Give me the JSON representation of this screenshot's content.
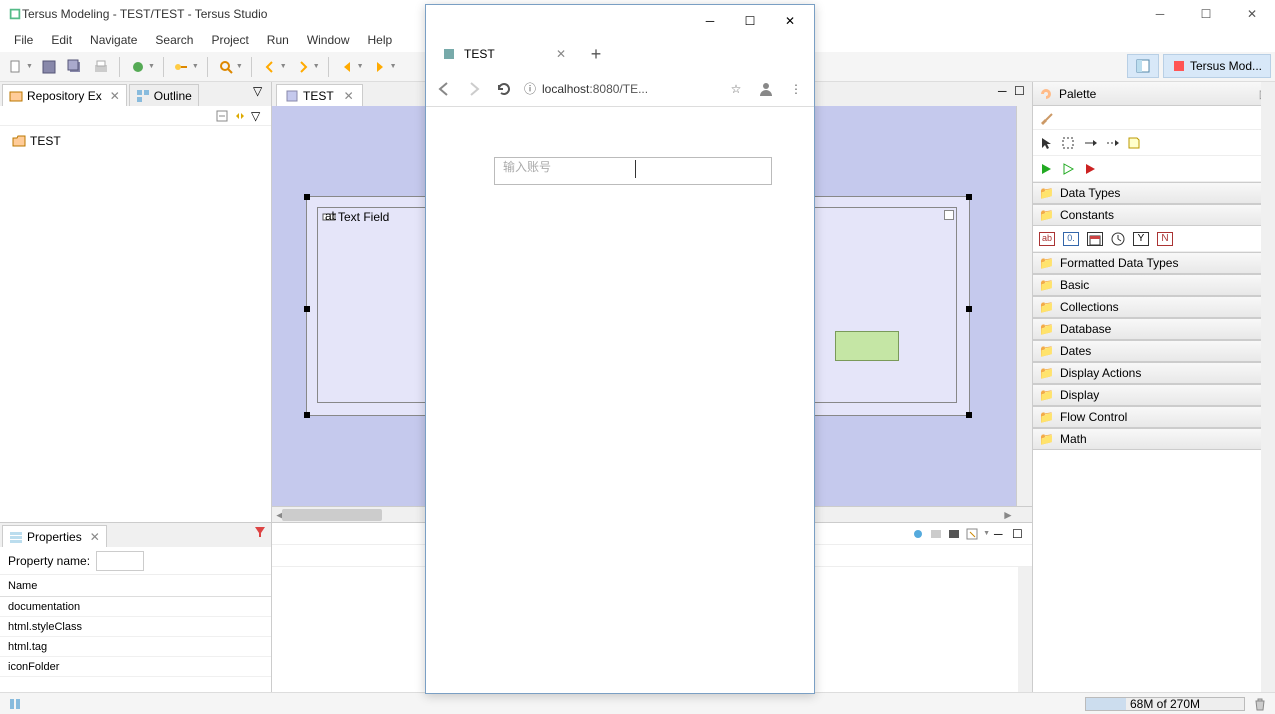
{
  "window": {
    "title": "Tersus Modeling - TEST/TEST - Tersus Studio"
  },
  "menu": {
    "file": "File",
    "edit": "Edit",
    "navigate": "Navigate",
    "search": "Search",
    "project": "Project",
    "run": "Run",
    "window": "Window",
    "help": "Help"
  },
  "perspective": {
    "label": "Tersus Mod..."
  },
  "left": {
    "tab_repo": "Repository Ex",
    "tab_outline": "Outline",
    "tree_root": "TEST"
  },
  "editor": {
    "tab": "TEST",
    "textfield_label": "Text Field"
  },
  "properties": {
    "tab": "Properties",
    "name_label": "Property name:",
    "col_name": "Name",
    "rows": [
      "documentation",
      "html.styleClass",
      "html.tag",
      "iconFolder"
    ]
  },
  "palette": {
    "title": "Palette",
    "drawers": [
      "Data Types",
      "Constants",
      "Formatted Data Types",
      "Basic",
      "Collections",
      "Database",
      "Dates",
      "Display Actions",
      "Display",
      "Flow Control",
      "Math"
    ]
  },
  "status": {
    "mem": "68M of 270M"
  },
  "browser": {
    "tab_title": "TEST",
    "url_info": "ⓘ",
    "url_host": "localhost",
    "url_port": ":8080",
    "url_path": "/TE...",
    "input_placeholder": "输入账号"
  }
}
